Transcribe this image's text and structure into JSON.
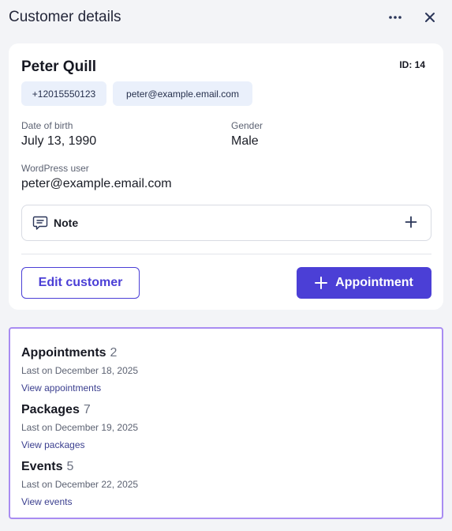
{
  "header": {
    "title": "Customer details",
    "more_icon": "more-horizontal-icon",
    "close_icon": "close-icon"
  },
  "customer": {
    "name": "Peter Quill",
    "id_label": "ID: 14",
    "phone": "+12015550123",
    "email": "peter@example.email.com",
    "dob_label": "Date of birth",
    "dob_value": "July 13, 1990",
    "gender_label": "Gender",
    "gender_value": "Male",
    "wp_label": "WordPress user",
    "wp_value": "peter@example.email.com"
  },
  "note": {
    "label": "Note",
    "icon": "speech-bubble-icon",
    "add_icon": "plus-icon"
  },
  "actions": {
    "edit_label": "Edit customer",
    "appointment_label": "Appointment"
  },
  "summary": {
    "appointments": {
      "title": "Appointments",
      "count": "2",
      "last": "Last on December 18, 2025",
      "link": "View appointments"
    },
    "packages": {
      "title": "Packages",
      "count": "7",
      "last": "Last on December 19, 2025",
      "link": "View packages"
    },
    "events": {
      "title": "Events",
      "count": "5",
      "last": "Last on December 22, 2025",
      "link": "View events"
    }
  },
  "colors": {
    "accent": "#4b3fd6",
    "chip_bg": "#eaf0fb",
    "highlight_border": "#a98cf2",
    "page_bg": "#f3f4f7"
  }
}
